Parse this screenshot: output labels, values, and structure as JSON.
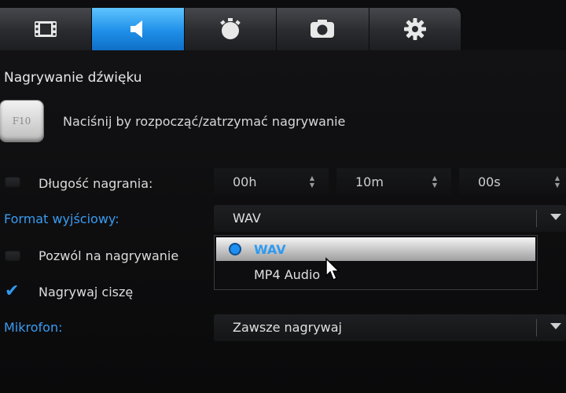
{
  "tabs": [
    {
      "name": "video",
      "icon": "film-icon",
      "active": false
    },
    {
      "name": "audio",
      "icon": "speaker-icon",
      "active": true
    },
    {
      "name": "timer",
      "icon": "stopwatch-icon",
      "active": false
    },
    {
      "name": "screenshot",
      "icon": "camera-icon",
      "active": false
    },
    {
      "name": "settings",
      "icon": "gear-icon",
      "active": false
    }
  ],
  "section": {
    "title": "Nagrywanie dźwięku"
  },
  "hotkey": {
    "key": "F10",
    "description": "Naciśnij by rozpocząć/zatrzymać nagrywanie"
  },
  "duration": {
    "label": "Długość nagrania:",
    "checked": false,
    "hours": "00h",
    "minutes": "10m",
    "seconds": "00s"
  },
  "output_format": {
    "label": "Format wyjściowy:",
    "selected": "WAV",
    "options": [
      "WAV",
      "MP4 Audio"
    ]
  },
  "allow_recording": {
    "label": "Pozwól na nagrywanie",
    "checked": false
  },
  "record_silence": {
    "label": "Nagrywaj ciszę",
    "checked": true
  },
  "microphone": {
    "label": "Mikrofon:",
    "selected": "Zawsze nagrywaj"
  },
  "colors": {
    "accent": "#1f8fe8",
    "label_blue": "#3a9cf2",
    "background": "#0d0d0f"
  }
}
